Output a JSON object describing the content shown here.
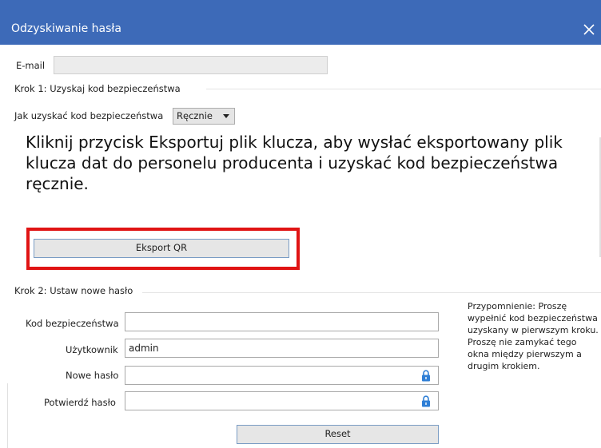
{
  "window": {
    "title": "Odzyskiwanie hasła",
    "close_icon": "close-icon",
    "titlebar_color": "#3d6ab8"
  },
  "email": {
    "label": "E-mail",
    "value": ""
  },
  "step1": {
    "heading": "Krok 1: Uzyskaj kod bezpieczeństwa",
    "method_label": "Jak uzyskać kod bezpieczeństwa",
    "method_selected": "Ręcznie",
    "instruction": "Kliknij przycisk Eksportuj plik klucza, aby wysłać eksportowany plik klucza dat do personelu producenta i uzyskać kod bezpieczeństwa ręcznie.",
    "export_button": "Eksport QR",
    "highlight_color": "#e01414"
  },
  "step2": {
    "heading": "Krok 2: Ustaw nowe hasło",
    "security_code_label": "Kod bezpieczeństwa",
    "security_code_value": "",
    "user_label": "Użytkownik",
    "user_value": "admin",
    "new_password_label": "Nowe hasło",
    "new_password_value": "",
    "confirm_password_label": "Potwierdź hasło",
    "confirm_password_value": "",
    "lock_icon": "lock-icon",
    "lock_color": "#2f7fd6",
    "reset_button": "Reset",
    "reminder": "Przypomnienie: Proszę wypełnić kod bezpieczeństwa uzyskany w pierwszym kroku. Proszę nie zamykać tego okna między pierwszym a drugim krokiem."
  }
}
